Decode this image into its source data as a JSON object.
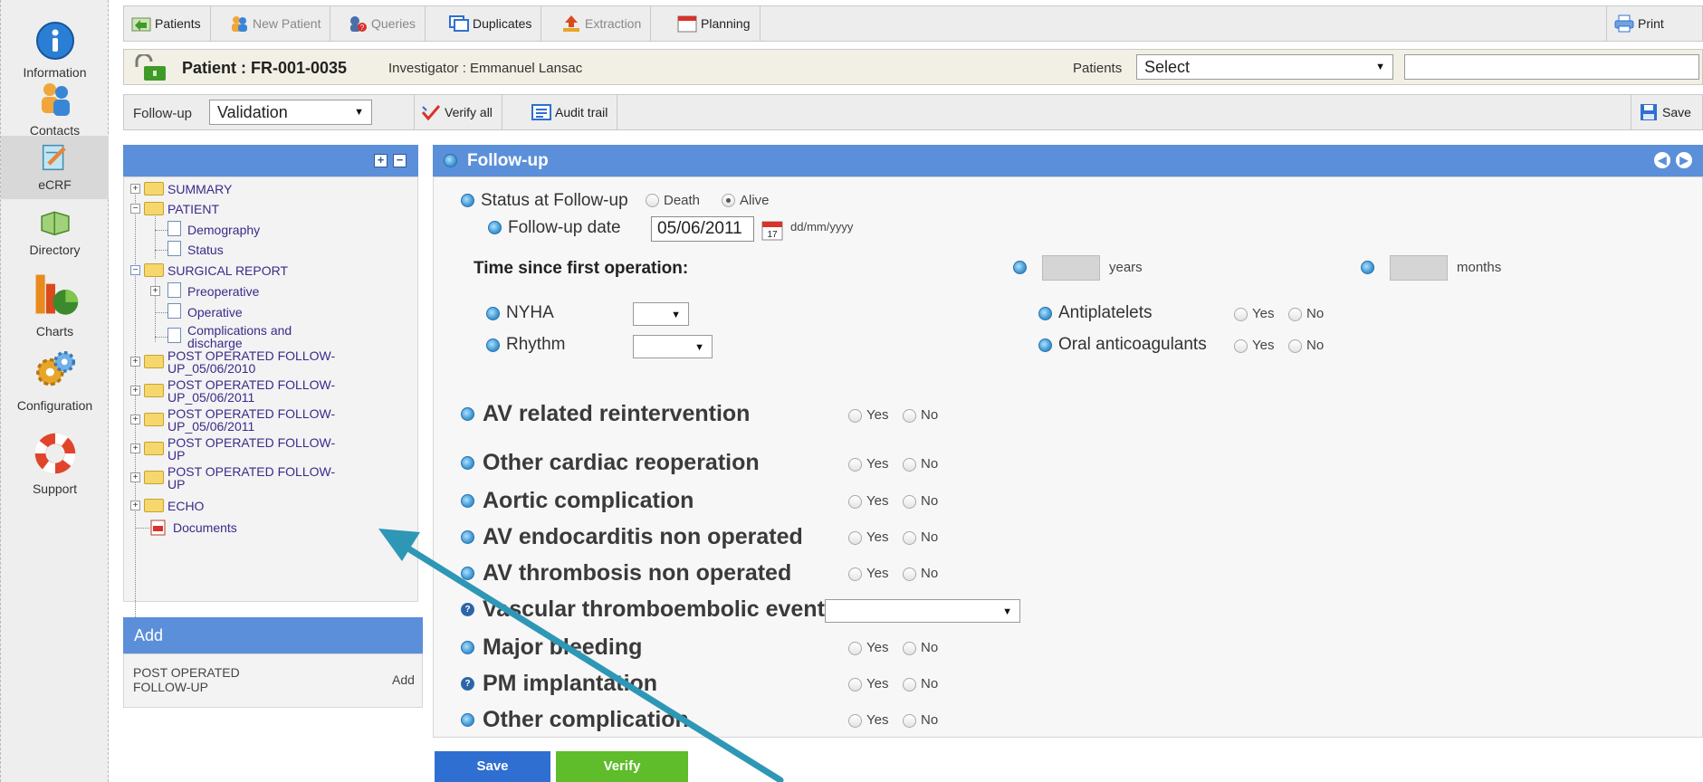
{
  "sidebar": {
    "items": [
      {
        "label": "Information",
        "icon": "info-icon"
      },
      {
        "label": "Contacts",
        "icon": "contacts-icon"
      },
      {
        "label": "eCRF",
        "icon": "ecrf-icon"
      },
      {
        "label": "Directory",
        "icon": "directory-icon"
      },
      {
        "label": "Charts",
        "icon": "charts-icon"
      },
      {
        "label": "Configuration",
        "icon": "configuration-icon"
      },
      {
        "label": "Support",
        "icon": "support-icon"
      }
    ]
  },
  "toolbar": {
    "patients": "Patients",
    "new_patient": "New Patient",
    "queries": "Queries",
    "duplicates": "Duplicates",
    "extraction": "Extraction",
    "planning": "Planning",
    "print": "Print"
  },
  "patient_bar": {
    "patient": "Patient : FR-001-0035",
    "investigator": "Investigator : Emmanuel Lansac",
    "patients_label": "Patients",
    "patients_select": "Select",
    "search_value": ""
  },
  "followup_bar": {
    "label": "Follow-up",
    "select": "Validation",
    "verify_all": "Verify all",
    "audit_trail": "Audit trail",
    "save": "Save"
  },
  "tree": {
    "nodes": [
      "SUMMARY",
      "PATIENT",
      "Demography",
      "Status",
      "SURGICAL REPORT",
      "Preoperative",
      "Operative",
      "Complications and",
      "discharge",
      "POST OPERATED FOLLOW-",
      "UP_05/06/2010",
      "POST OPERATED FOLLOW-",
      "UP_05/06/2011",
      "POST OPERATED FOLLOW-",
      "UP_05/06/2011",
      "POST OPERATED FOLLOW-",
      "UP",
      "POST OPERATED FOLLOW-",
      "UP",
      "ECHO",
      "Documents"
    ]
  },
  "add_panel": {
    "title": "Add",
    "item_line1": "POST OPERATED",
    "item_line2": "FOLLOW-UP",
    "add_link": "Add"
  },
  "form": {
    "title": "Follow-up",
    "status_label": "Status at Follow-up",
    "status_death": "Death",
    "status_alive": "Alive",
    "status_selected": "Alive",
    "date_label": "Follow-up date",
    "date_value": "05/06/2011",
    "date_format": "dd/mm/yyyy",
    "time_since": "Time since first operation:",
    "years": "years",
    "months": "months",
    "nyha": "NYHA",
    "rhythm": "Rhythm",
    "antiplatelets": "Antiplatelets",
    "oral_anticoagulants": "Oral anticoagulants",
    "yes": "Yes",
    "no": "No",
    "questions": [
      "AV related reintervention",
      "Other cardiac reoperation",
      "Aortic complication",
      "AV endocarditis non operated",
      "AV thrombosis non operated",
      "Vascular thromboembolic event",
      "Major bleeding",
      "PM implantation",
      "Other complication"
    ]
  },
  "buttons": {
    "save": "Save",
    "verify": "Verify"
  },
  "colors": {
    "panel_header": "#5b8fd9",
    "save_button": "#2f6fd1",
    "verify_button": "#5fbd2b",
    "annotation_arrow": "#2e97b6"
  }
}
